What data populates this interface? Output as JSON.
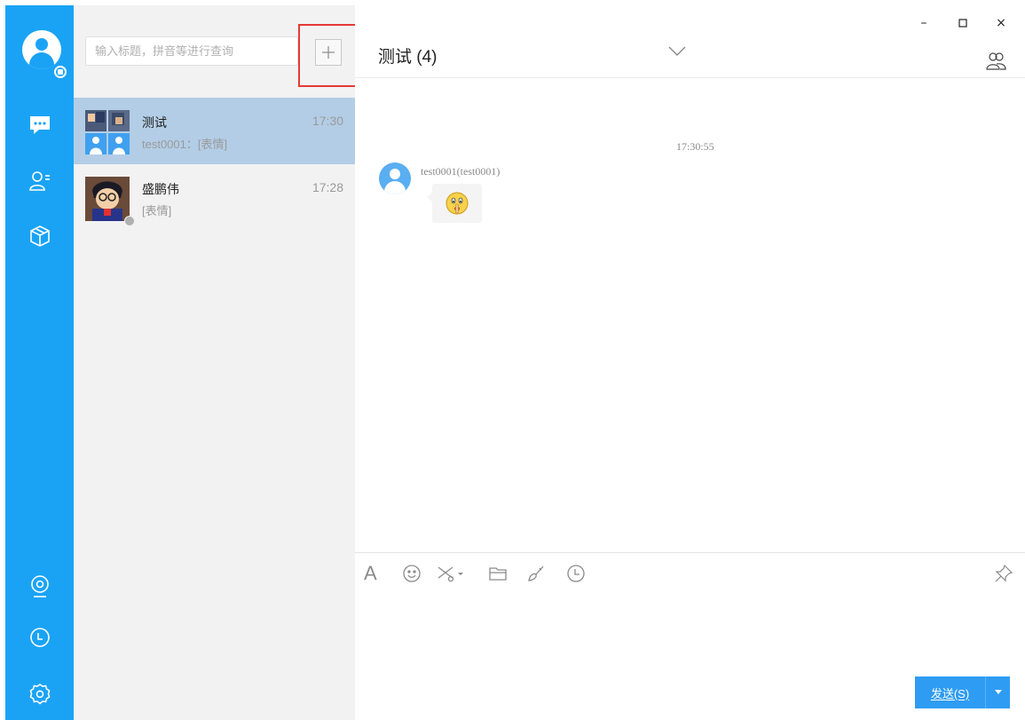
{
  "search": {
    "placeholder": "输入标题，拼音等进行查询"
  },
  "conversations": [
    {
      "name": "测试",
      "time": "17:30",
      "preview": "test0001：[表情]"
    },
    {
      "name": "盛鹏伟",
      "time": "17:28",
      "preview": "[表情]"
    }
  ],
  "chat": {
    "title": "测试 (4)",
    "messages": [
      {
        "time": "17:30:55",
        "sender": "test0001(test0001)",
        "content_icon": "shush-emoji-icon"
      }
    ]
  },
  "composer": {
    "font_label": "A",
    "send_label": "发送(S)"
  },
  "window": {
    "minimize": "–",
    "close": "×"
  },
  "colors": {
    "sidebar": "#1aa3f5",
    "selected_item": "#b3cde6",
    "send_button": "#2f9cf3",
    "highlight": "#e53935"
  }
}
